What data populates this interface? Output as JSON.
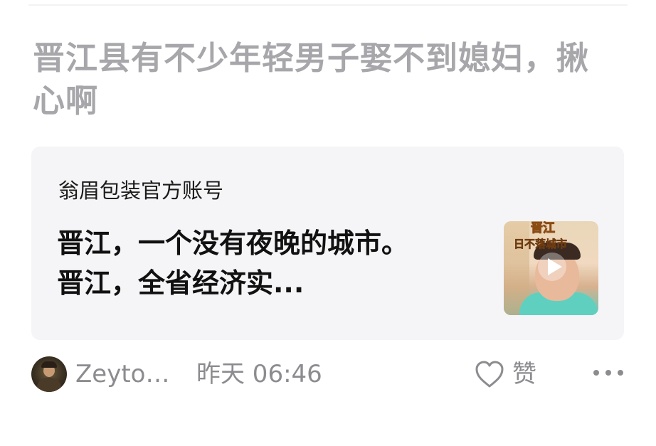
{
  "post": {
    "title": "晋江县有不少年轻男子娶不到媳妇，揪心啊"
  },
  "card": {
    "source": "翁眉包装官方账号",
    "text_line1": "晋江，一个没有夜晚的城市。",
    "text_line2": "晋江，全省经济实...",
    "thumb_label_1": "晋江",
    "thumb_label_2": "日不落城市"
  },
  "footer": {
    "author": "Zeyto…",
    "time": "昨天  06:46",
    "like_label": "赞"
  },
  "colors": {
    "title": "#a7a7ab",
    "card_bg": "#f5f5f7",
    "meta": "#8c8c90"
  },
  "icons": {
    "like": "heart-icon",
    "more": "more-horizontal-icon",
    "play": "play-icon"
  }
}
